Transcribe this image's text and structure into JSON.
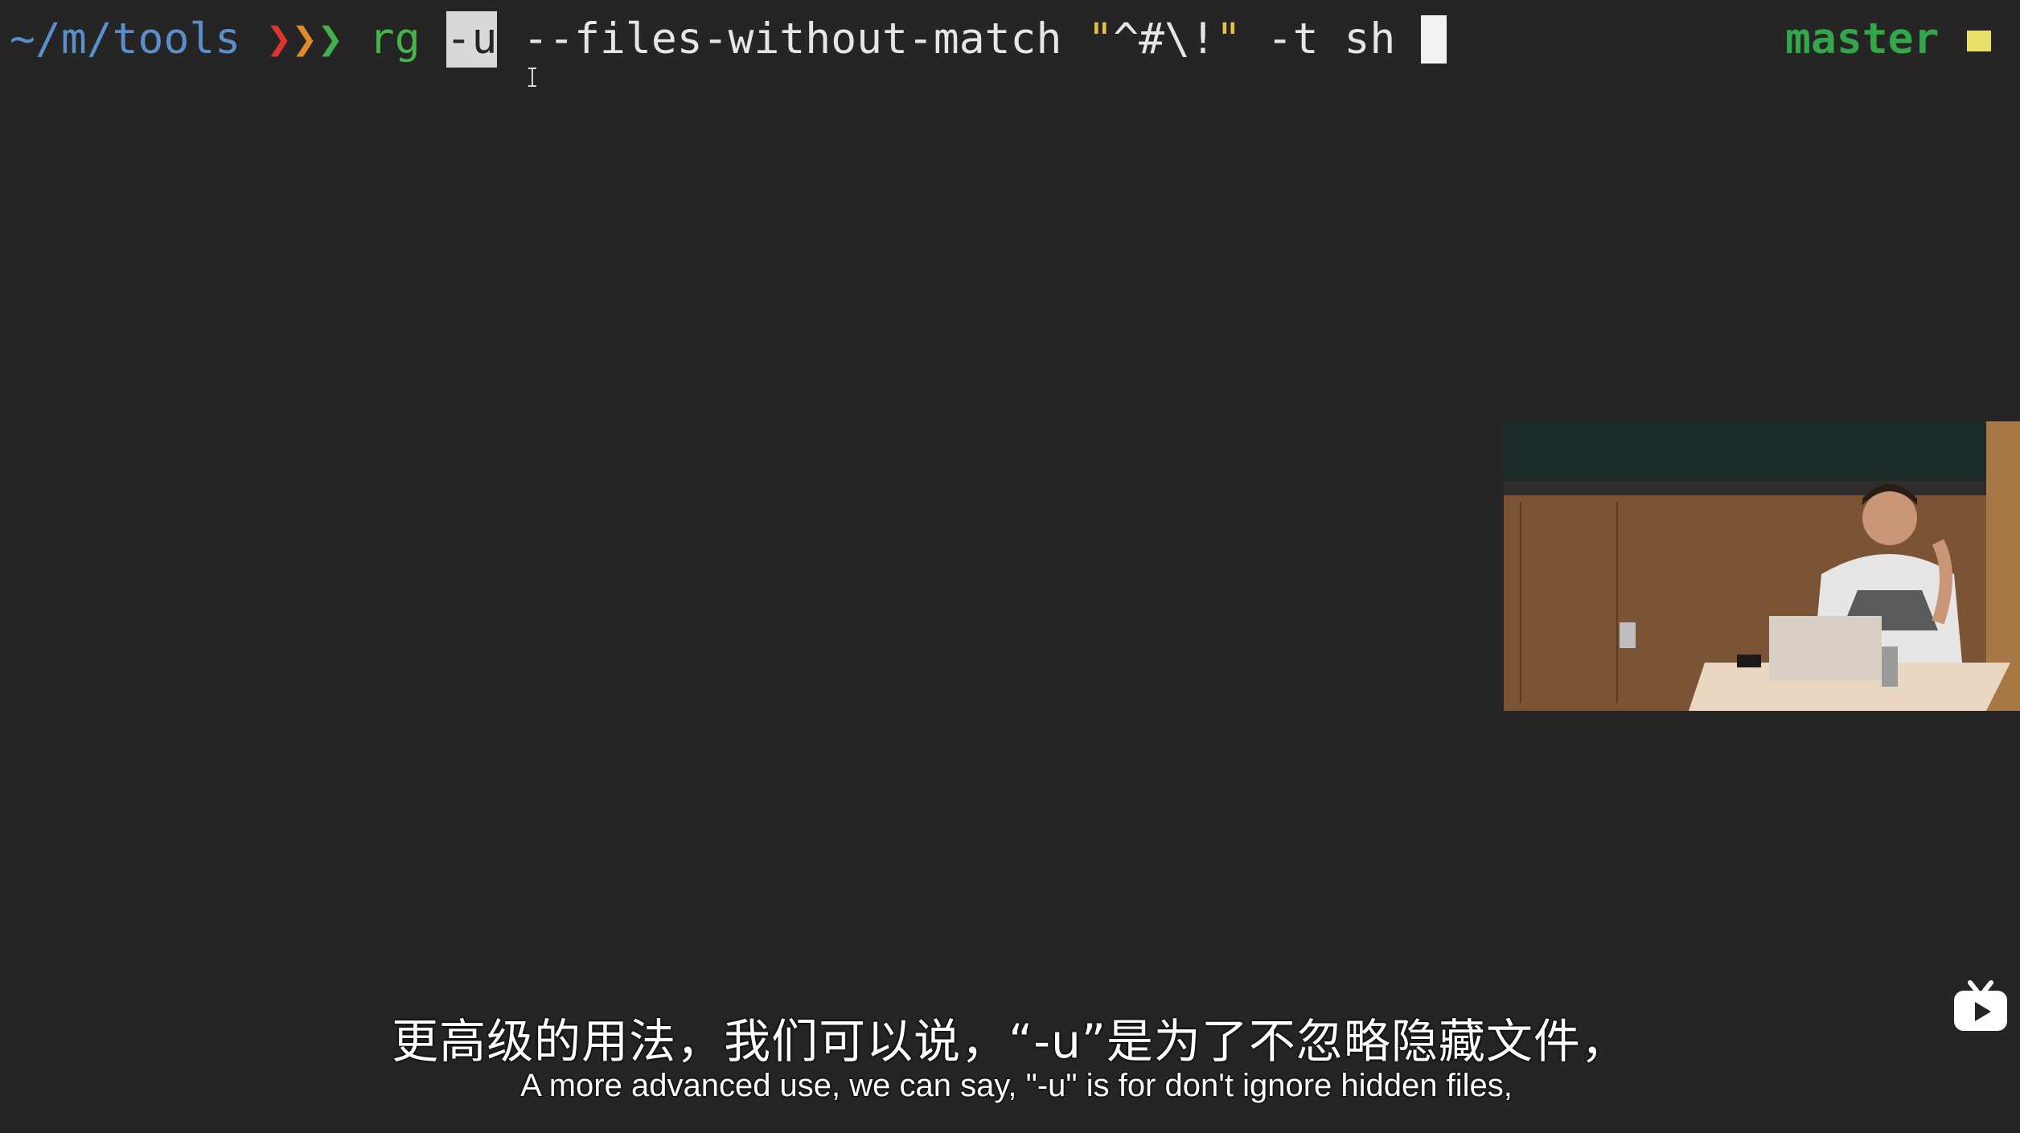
{
  "terminal": {
    "cwd": "~/m/tools",
    "prompt_arrows": [
      "❯",
      "❯",
      "❯"
    ],
    "command": "rg",
    "flag_selected": "-u",
    "args_1": "--files-without-match",
    "pattern_open_quote": "\"",
    "pattern_body": "^#\\!",
    "pattern_close_quote": "\"",
    "args_2": "-t sh",
    "git_branch": "master"
  },
  "subtitles": {
    "chinese": "更高级的用法，我们可以说，“-u”是为了不忽略隐藏文件，",
    "english": "A more advanced use, we can say, \"-u\" is for don't ignore hidden files,"
  },
  "icons": {
    "cursor": "i-beam-cursor-icon",
    "branch_status": "dirty-status-square-icon",
    "logo": "video-platform-logo-icon"
  },
  "colors": {
    "background": "#252525",
    "cwd": "#5b8fc9",
    "command": "#46b448",
    "branch": "#33a64a",
    "string_quote": "#e2c24a"
  }
}
